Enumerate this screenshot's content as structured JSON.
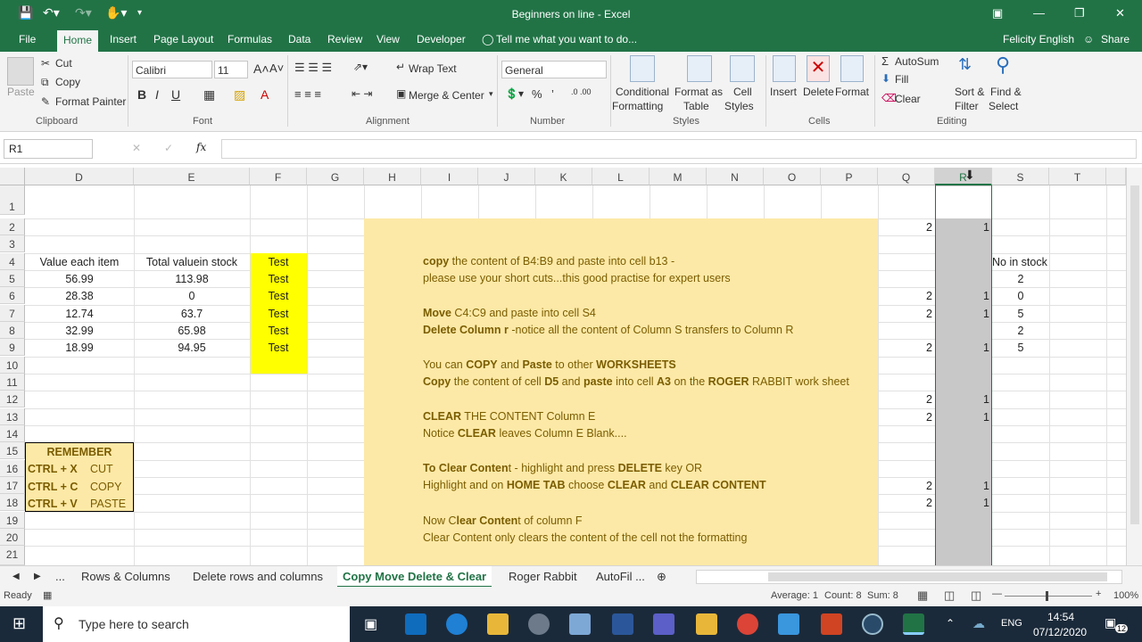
{
  "window": {
    "title": "Beginners on line - Excel"
  },
  "tabs": {
    "file": "File",
    "home": "Home",
    "insert": "Insert",
    "page_layout": "Page Layout",
    "formulas": "Formulas",
    "data": "Data",
    "review": "Review",
    "view": "View",
    "developer": "Developer",
    "tellme": "Tell me what you want to do...",
    "user": "Felicity English",
    "share": "Share"
  },
  "ribbon": {
    "cut": "Cut",
    "copy": "Copy",
    "format_painter": "Format Painter",
    "paste": "Paste",
    "clipboard": "Clipboard",
    "font_name": "Calibri",
    "font_size": "11",
    "font": "Font",
    "wrap_text": "Wrap Text",
    "merge_center": "Merge & Center",
    "alignment": "Alignment",
    "number_format": "General",
    "number": "Number",
    "conditional": "Conditional",
    "formatting": "Formatting",
    "format_as": "Format as",
    "table": "Table",
    "cell": "Cell",
    "styles_btn": "Styles",
    "styles": "Styles",
    "insert": "Insert",
    "delete": "Delete",
    "format": "Format",
    "cells": "Cells",
    "autosum": "AutoSum",
    "fill": "Fill",
    "clear": "Clear",
    "sort": "Sort &",
    "filter": "Filter",
    "find": "Find &",
    "select": "Select",
    "editing": "Editing"
  },
  "formula": {
    "namebox": "R1",
    "fx": "fx"
  },
  "columns": [
    "D",
    "E",
    "F",
    "G",
    "H",
    "I",
    "J",
    "K",
    "L",
    "M",
    "N",
    "O",
    "P",
    "Q",
    "R",
    "S",
    "T"
  ],
  "rows": [
    "1",
    "2",
    "3",
    "4",
    "5",
    "6",
    "7",
    "8",
    "9",
    "10",
    "11",
    "12",
    "13",
    "14",
    "15",
    "16",
    "17",
    "18",
    "19",
    "20",
    "21"
  ],
  "cells": {
    "d4": "Value each item",
    "e4": "Total valuein stock",
    "d": [
      "56.99",
      "28.38",
      "12.74",
      "32.99",
      "18.99"
    ],
    "e": [
      "113.98",
      "0",
      "63.7",
      "65.98",
      "94.95"
    ],
    "f": [
      "Test",
      "Test",
      "Test",
      "Test",
      "Test",
      "Test"
    ],
    "q2": "2",
    "r2": "1",
    "q6": "2",
    "r6": "1",
    "q7": "2",
    "r7": "1",
    "q9": "2",
    "r9": "1",
    "q12": "2",
    "r12": "1",
    "q13": "2",
    "r13": "1",
    "q17": "2",
    "r17": "1",
    "q18": "2",
    "r18": "1",
    "s4": "No in stock",
    "s": [
      "2",
      "0",
      "5",
      "2",
      "5"
    ],
    "remember": "REMEMBER",
    "keys": [
      [
        "CTRL + X",
        "CUT"
      ],
      [
        "CTRL + C",
        "COPY"
      ],
      [
        "CTRL + V",
        "PASTE"
      ]
    ]
  },
  "note": {
    "l1a": "copy",
    "l1b": " the content of B4:B9 and paste into cell b13 -",
    "l2": "please use your short cuts...this good practise for expert users",
    "l3a": "Move",
    "l3b": " C4:C9 and paste into cell S4",
    "l4a": "Delete Column r",
    "l4b": " -notice all the content of Column S transfers to Column R",
    "l5a": "You can ",
    "l5b": "COPY",
    "l5c": " and ",
    "l5d": "Paste",
    "l5e": " to other ",
    "l5f": "WORKSHEETS",
    "l6a": "Copy",
    "l6b": " the content of cell ",
    "l6c": "D5",
    "l6d": " and ",
    "l6e": "paste",
    "l6f": " into cell ",
    "l6g": "A3",
    "l6h": " on the ",
    "l6i": "ROGER",
    "l6j": " RABBIT work sheet",
    "l7a": "CLEAR",
    "l7b": " THE CONTENT Column E",
    "l8a": "Notice ",
    "l8b": "CLEAR",
    "l8c": " leaves Column E Blank....",
    "l9a": "To Clear Conten",
    "l9b": "t - highlight and press ",
    "l9c": "DELETE",
    "l9d": " key   OR",
    "l10a": "Highlight and on ",
    "l10b": "HOME TAB",
    "l10c": " choose ",
    "l10d": "CLEAR",
    "l10e": " and ",
    "l10f": "CLEAR CONTENT",
    "l11a": "Now C",
    "l11b": "lear Conten",
    "l11c": "t of column F",
    "l12": "Clear Content only clears the content of the cell not the formatting"
  },
  "sheets": [
    "...",
    "Rows & Columns",
    "Delete rows and columns",
    "Copy Move Delete & Clear",
    "Roger Rabbit",
    "AutoFil ..."
  ],
  "status": {
    "ready": "Ready",
    "average": "Average: 1",
    "count": "Count: 8",
    "sum": "Sum: 8",
    "zoom": "100%"
  },
  "taskbar": {
    "search": "Type here to search",
    "lang": "ENG",
    "time": "14:54",
    "date": "07/12/2020",
    "notif": "12"
  }
}
